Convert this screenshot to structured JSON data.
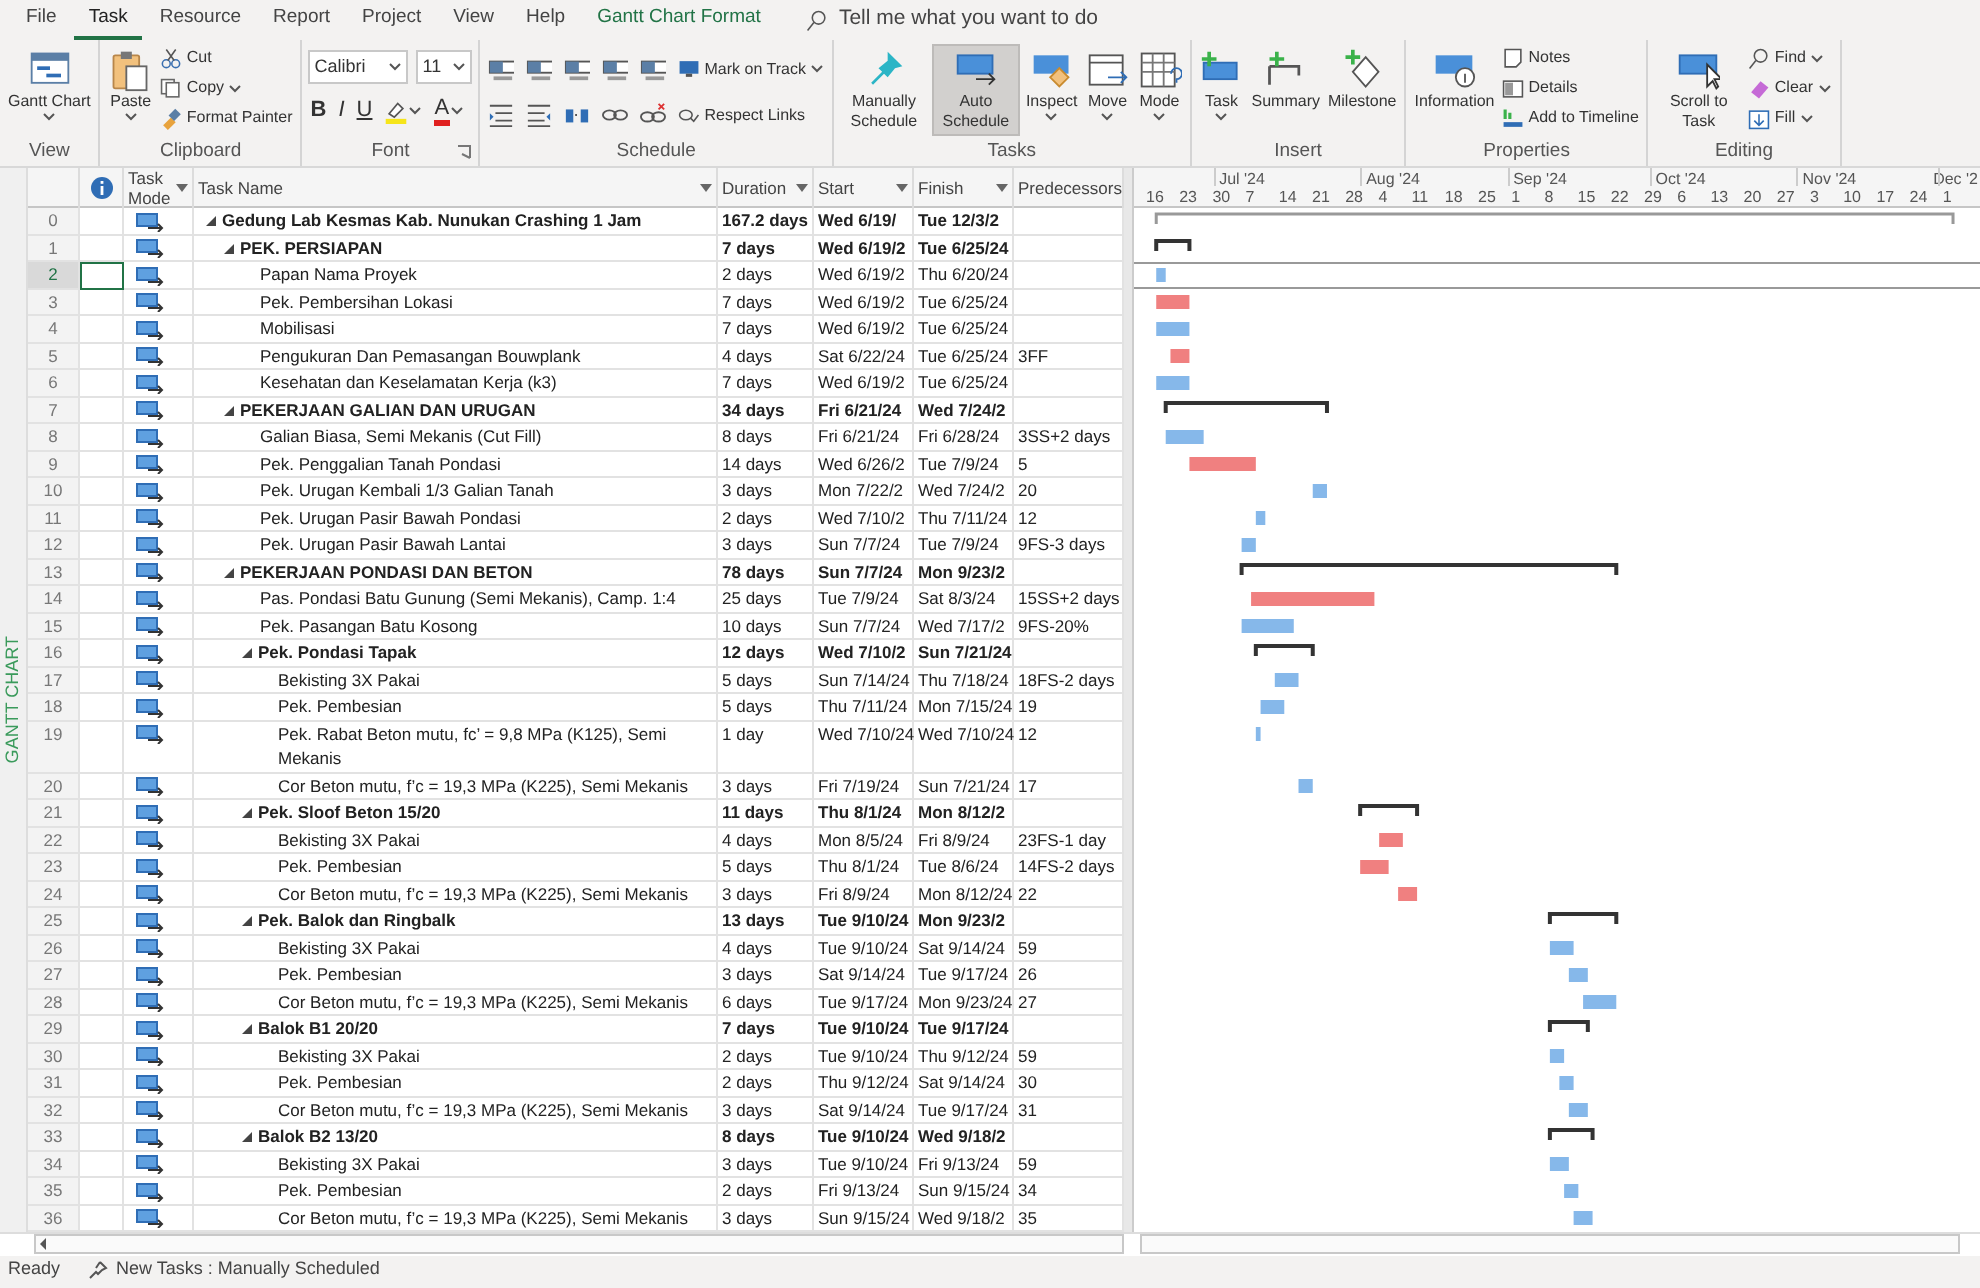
{
  "ribbon_tabs": [
    {
      "label": "File",
      "selected": false
    },
    {
      "label": "Task",
      "selected": true
    },
    {
      "label": "Resource",
      "selected": false
    },
    {
      "label": "Report",
      "selected": false
    },
    {
      "label": "Project",
      "selected": false
    },
    {
      "label": "View",
      "selected": false
    },
    {
      "label": "Help",
      "selected": false
    },
    {
      "label": "Gantt Chart Format",
      "selected": false,
      "kind": "contextual"
    }
  ],
  "tell_me": {
    "placeholder": "Tell me what you want to do"
  },
  "ribbon_groups": [
    {
      "label": "View",
      "items": [
        {
          "kind": "large",
          "label": "Gantt Chart",
          "dropdown": true,
          "selected": false
        }
      ]
    },
    {
      "label": "Clipboard",
      "items": [
        {
          "kind": "large",
          "label": "Paste",
          "dropdown": true,
          "selected": false
        },
        {
          "kind": "small",
          "label": "Cut",
          "dropdown": false
        },
        {
          "kind": "small",
          "label": "Copy",
          "dropdown": true
        },
        {
          "kind": "small",
          "label": "Format Painter",
          "dropdown": false
        }
      ]
    },
    {
      "label": "Font",
      "launcher": true,
      "items": [
        {
          "kind": "font-name",
          "value": "Calibri"
        },
        {
          "kind": "font-size",
          "value": "11"
        },
        {
          "kind": "bold",
          "label": "B"
        },
        {
          "kind": "italic",
          "label": "I"
        },
        {
          "kind": "underline",
          "label": "U"
        },
        {
          "kind": "icon",
          "dropdown": true
        },
        {
          "kind": "font-color",
          "label": "A",
          "dropdown": true
        }
      ]
    },
    {
      "label": "Schedule",
      "items": [
        {
          "kind": "icon"
        },
        {
          "kind": "icon"
        },
        {
          "kind": "icon"
        },
        {
          "kind": "icon"
        },
        {
          "kind": "icon"
        },
        {
          "kind": "small",
          "label": "Mark on Track",
          "dropdown": true
        },
        {
          "kind": "icon"
        },
        {
          "kind": "icon"
        },
        {
          "kind": "icon"
        },
        {
          "kind": "icon"
        },
        {
          "kind": "icon"
        },
        {
          "kind": "small",
          "label": "Respect Links",
          "dropdown": false
        }
      ]
    },
    {
      "label": "Tasks",
      "items": [
        {
          "kind": "large",
          "label": "Manually Schedule",
          "dropdown": false,
          "selected": false
        },
        {
          "kind": "large",
          "label": "Auto Schedule",
          "dropdown": false,
          "selected": true
        },
        {
          "kind": "large",
          "label": "Inspect",
          "dropdown": true,
          "selected": false
        },
        {
          "kind": "large",
          "label": "Move",
          "dropdown": true,
          "selected": false
        },
        {
          "kind": "large",
          "label": "Mode",
          "dropdown": true,
          "selected": false
        }
      ]
    },
    {
      "label": "Insert",
      "items": [
        {
          "kind": "large",
          "label": "Task",
          "dropdown": true,
          "selected": false
        },
        {
          "kind": "large",
          "label": "Summary",
          "dropdown": false,
          "selected": false
        },
        {
          "kind": "large",
          "label": "Milestone",
          "dropdown": false,
          "selected": false
        }
      ]
    },
    {
      "label": "Properties",
      "items": [
        {
          "kind": "large",
          "label": "Information",
          "dropdown": false,
          "selected": false
        },
        {
          "kind": "small",
          "label": "Notes",
          "dropdown": false
        },
        {
          "kind": "small",
          "label": "Details",
          "dropdown": false
        },
        {
          "kind": "small",
          "label": "Add to Timeline",
          "dropdown": false
        }
      ]
    },
    {
      "label": "Editing",
      "items": [
        {
          "kind": "large",
          "label": "Scroll to Task",
          "dropdown": false,
          "selected": false
        },
        {
          "kind": "small",
          "label": "Find",
          "dropdown": true
        },
        {
          "kind": "small",
          "label": "Clear",
          "dropdown": true
        },
        {
          "kind": "small",
          "label": "Fill",
          "dropdown": true
        }
      ]
    }
  ],
  "side_label": "GANTT CHART",
  "table": {
    "columns": [
      "Task Mode",
      "Task Name",
      "Duration",
      "Start",
      "Finish",
      "Predecessors"
    ],
    "rows": [
      {
        "id": "0",
        "name": "Gedung Lab Kesmas Kab. Nunukan Crashing 1 Jam",
        "duration": "167.2 days",
        "start": "Wed 6/19/",
        "finish": "Tue 12/3/2",
        "kind": "summary",
        "expanded": true,
        "selected": false,
        "children": [
          {
            "id": "1",
            "name": "PEK. PERSIAPAN",
            "duration": "7 days",
            "start": "Wed 6/19/2",
            "finish": "Tue 6/25/24",
            "kind": "summary",
            "expanded": true,
            "selected": false,
            "children": [
              {
                "id": "2",
                "name": "Papan Nama Proyek",
                "duration": "2 days",
                "start": "Wed 6/19/2",
                "finish": "Thu 6/20/24",
                "kind": "task",
                "critical": false,
                "selected": true
              },
              {
                "id": "3",
                "name": "Pek. Pembersihan Lokasi",
                "duration": "7 days",
                "start": "Wed 6/19/2",
                "finish": "Tue 6/25/24",
                "kind": "task",
                "critical": true,
                "selected": false
              },
              {
                "id": "4",
                "name": "Mobilisasi",
                "duration": "7 days",
                "start": "Wed 6/19/2",
                "finish": "Tue 6/25/24",
                "kind": "task",
                "critical": false,
                "selected": false
              },
              {
                "id": "5",
                "name": "Pengukuran Dan Pemasangan Bouwplank",
                "duration": "4 days",
                "start": "Sat 6/22/24",
                "finish": "Tue 6/25/24",
                "predecessors": "3FF",
                "kind": "task",
                "critical": true,
                "selected": false
              },
              {
                "id": "6",
                "name": "Kesehatan dan Keselamatan Kerja (k3)",
                "duration": "7 days",
                "start": "Wed 6/19/2",
                "finish": "Tue 6/25/24",
                "kind": "task",
                "critical": false,
                "selected": false
              }
            ]
          },
          {
            "id": "7",
            "name": "PEKERJAAN GALIAN DAN URUGAN",
            "duration": "34 days",
            "start": "Fri 6/21/24",
            "finish": "Wed 7/24/2",
            "kind": "summary",
            "expanded": true,
            "selected": false,
            "children": [
              {
                "id": "8",
                "name": "Galian Biasa, Semi Mekanis (Cut Fill)",
                "duration": "8 days",
                "start": "Fri 6/21/24",
                "finish": "Fri 6/28/24",
                "predecessors": "3SS+2 days",
                "kind": "task",
                "critical": false,
                "selected": false
              },
              {
                "id": "9",
                "name": "Pek. Penggalian Tanah Pondasi",
                "duration": "14 days",
                "start": "Wed 6/26/2",
                "finish": "Tue 7/9/24",
                "predecessors": "5",
                "kind": "task",
                "critical": true,
                "selected": false
              },
              {
                "id": "10",
                "name": "Pek. Urugan Kembali 1/3 Galian Tanah",
                "duration": "3 days",
                "start": "Mon 7/22/2",
                "finish": "Wed 7/24/2",
                "predecessors": "20",
                "kind": "task",
                "critical": false,
                "selected": false
              },
              {
                "id": "11",
                "name": "Pek. Urugan Pasir Bawah Pondasi",
                "duration": "2 days",
                "start": "Wed 7/10/2",
                "finish": "Thu 7/11/24",
                "predecessors": "12",
                "kind": "task",
                "critical": false,
                "selected": false
              },
              {
                "id": "12",
                "name": "Pek. Urugan Pasir Bawah Lantai",
                "duration": "3 days",
                "start": "Sun 7/7/24",
                "finish": "Tue 7/9/24",
                "predecessors": "9FS-3 days",
                "kind": "task",
                "critical": false,
                "selected": false
              }
            ]
          },
          {
            "id": "13",
            "name": "PEKERJAAN PONDASI DAN BETON",
            "duration": "78 days",
            "start": "Sun 7/7/24",
            "finish": "Mon 9/23/2",
            "kind": "summary",
            "expanded": true,
            "selected": false,
            "children": [
              {
                "id": "14",
                "name": "Pas. Pondasi Batu Gunung (Semi Mekanis), Camp. 1:4",
                "duration": "25 days",
                "start": "Tue 7/9/24",
                "finish": "Sat 8/3/24",
                "predecessors": "15SS+2 days",
                "kind": "task",
                "critical": true,
                "selected": false
              },
              {
                "id": "15",
                "name": "Pek. Pasangan Batu Kosong",
                "duration": "10 days",
                "start": "Sun 7/7/24",
                "finish": "Wed 7/17/2",
                "predecessors": "9FS-20%",
                "kind": "task",
                "critical": false,
                "selected": false
              },
              {
                "id": "16",
                "name": "Pek. Pondasi Tapak",
                "duration": "12 days",
                "start": "Wed 7/10/2",
                "finish": "Sun 7/21/24",
                "kind": "summary",
                "expanded": true,
                "selected": false,
                "children": [
                  {
                    "id": "17",
                    "name": "Bekisting 3X Pakai",
                    "duration": "5 days",
                    "start": "Sun 7/14/24",
                    "finish": "Thu 7/18/24",
                    "predecessors": "18FS-2 days",
                    "kind": "task",
                    "critical": false,
                    "selected": false
                  },
                  {
                    "id": "18",
                    "name": "Pek. Pembesian",
                    "duration": "5 days",
                    "start": "Thu 7/11/24",
                    "finish": "Mon 7/15/24",
                    "predecessors": "19",
                    "kind": "task",
                    "critical": false,
                    "selected": false
                  },
                  {
                    "id": "19",
                    "name": "Pek. Rabat Beton mutu, fc’ = 9,8 MPa (K125), Semi Mekanis",
                    "duration": "1 day",
                    "start": "Wed 7/10/24",
                    "finish": "Wed 7/10/24",
                    "predecessors": "12",
                    "kind": "task",
                    "critical": false,
                    "selected": false
                  },
                  {
                    "id": "20",
                    "name": "Cor Beton mutu, f’c = 19,3 MPa (K225), Semi Mekanis",
                    "duration": "3 days",
                    "start": "Fri 7/19/24",
                    "finish": "Sun 7/21/24",
                    "predecessors": "17",
                    "kind": "task",
                    "critical": false,
                    "selected": false
                  }
                ]
              },
              {
                "id": "21",
                "name": "Pek. Sloof Beton 15/20",
                "duration": "11 days",
                "start": "Thu 8/1/24",
                "finish": "Mon 8/12/2",
                "kind": "summary",
                "expanded": true,
                "selected": false,
                "children": [
                  {
                    "id": "22",
                    "name": "Bekisting 3X Pakai",
                    "duration": "4 days",
                    "start": "Mon 8/5/24",
                    "finish": "Fri 8/9/24",
                    "predecessors": "23FS-1 day",
                    "kind": "task",
                    "critical": true,
                    "selected": false
                  },
                  {
                    "id": "23",
                    "name": "Pek. Pembesian",
                    "duration": "5 days",
                    "start": "Thu 8/1/24",
                    "finish": "Tue 8/6/24",
                    "predecessors": "14FS-2 days",
                    "kind": "task",
                    "critical": true,
                    "selected": false
                  },
                  {
                    "id": "24",
                    "name": "Cor Beton mutu, f’c = 19,3 MPa (K225), Semi Mekanis",
                    "duration": "3 days",
                    "start": "Fri 8/9/24",
                    "finish": "Mon 8/12/24",
                    "predecessors": "22",
                    "kind": "task",
                    "critical": true,
                    "selected": false
                  }
                ]
              },
              {
                "id": "25",
                "name": "Pek. Balok dan Ringbalk",
                "duration": "13 days",
                "start": "Tue 9/10/24",
                "finish": "Mon 9/23/2",
                "kind": "summary",
                "expanded": true,
                "selected": false,
                "children": [
                  {
                    "id": "26",
                    "name": "Bekisting 3X Pakai",
                    "duration": "4 days",
                    "start": "Tue 9/10/24",
                    "finish": "Sat 9/14/24",
                    "predecessors": "59",
                    "kind": "task",
                    "critical": false,
                    "selected": false
                  },
                  {
                    "id": "27",
                    "name": "Pek. Pembesian",
                    "duration": "3 days",
                    "start": "Sat 9/14/24",
                    "finish": "Tue 9/17/24",
                    "predecessors": "26",
                    "kind": "task",
                    "critical": false,
                    "selected": false
                  },
                  {
                    "id": "28",
                    "name": "Cor Beton mutu, f’c = 19,3 MPa (K225), Semi Mekanis",
                    "duration": "6 days",
                    "start": "Tue 9/17/24",
                    "finish": "Mon 9/23/24",
                    "predecessors": "27",
                    "kind": "task",
                    "critical": false,
                    "selected": false
                  }
                ]
              },
              {
                "id": "29",
                "name": "Balok B1 20/20",
                "duration": "7 days",
                "start": "Tue 9/10/24",
                "finish": "Tue 9/17/24",
                "kind": "summary",
                "expanded": true,
                "selected": false,
                "children": [
                  {
                    "id": "30",
                    "name": "Bekisting 3X Pakai",
                    "duration": "2 days",
                    "start": "Tue 9/10/24",
                    "finish": "Thu 9/12/24",
                    "predecessors": "59",
                    "kind": "task",
                    "critical": false,
                    "selected": false
                  },
                  {
                    "id": "31",
                    "name": "Pek. Pembesian",
                    "duration": "2 days",
                    "start": "Thu 9/12/24",
                    "finish": "Sat 9/14/24",
                    "predecessors": "30",
                    "kind": "task",
                    "critical": false,
                    "selected": false
                  },
                  {
                    "id": "32",
                    "name": "Cor Beton mutu, f’c = 19,3 MPa (K225), Semi Mekanis",
                    "duration": "3 days",
                    "start": "Sat 9/14/24",
                    "finish": "Tue 9/17/24",
                    "predecessors": "31",
                    "kind": "task",
                    "critical": false,
                    "selected": false
                  }
                ]
              },
              {
                "id": "33",
                "name": "Balok B2 13/20",
                "duration": "8 days",
                "start": "Tue 9/10/24",
                "finish": "Wed 9/18/2",
                "kind": "summary",
                "expanded": true,
                "selected": false,
                "children": [
                  {
                    "id": "34",
                    "name": "Bekisting 3X Pakai",
                    "duration": "3 days",
                    "start": "Tue 9/10/24",
                    "finish": "Fri 9/13/24",
                    "predecessors": "59",
                    "kind": "task",
                    "critical": false,
                    "selected": false
                  },
                  {
                    "id": "35",
                    "name": "Pek. Pembesian",
                    "duration": "2 days",
                    "start": "Fri 9/13/24",
                    "finish": "Sun 9/15/24",
                    "predecessors": "34",
                    "kind": "task",
                    "critical": false,
                    "selected": false
                  },
                  {
                    "id": "36",
                    "name": "Cor Beton mutu, f’c = 19,3 MPa (K225), Semi Mekanis",
                    "duration": "3 days",
                    "start": "Sun 9/15/24",
                    "finish": "Wed 9/18/2",
                    "predecessors": "35",
                    "kind": "task",
                    "critical": false,
                    "selected": false
                  }
                ]
              }
            ]
          }
        ]
      }
    ]
  },
  "timescale": {
    "months": [
      "Jul '24",
      "Aug '24",
      "Sep '24",
      "Oct '24",
      "Nov '24",
      "Dec '2"
    ],
    "weeks": [
      "16",
      "23",
      "30",
      "7",
      "14",
      "21",
      "28",
      "4",
      "11",
      "18",
      "25",
      "1",
      "8",
      "15",
      "22",
      "29",
      "6",
      "13",
      "20",
      "27",
      "3",
      "10",
      "17",
      "24",
      "1"
    ]
  },
  "status_bar": {
    "state": "Ready",
    "new_tasks": "New Tasks : Manually Scheduled"
  }
}
